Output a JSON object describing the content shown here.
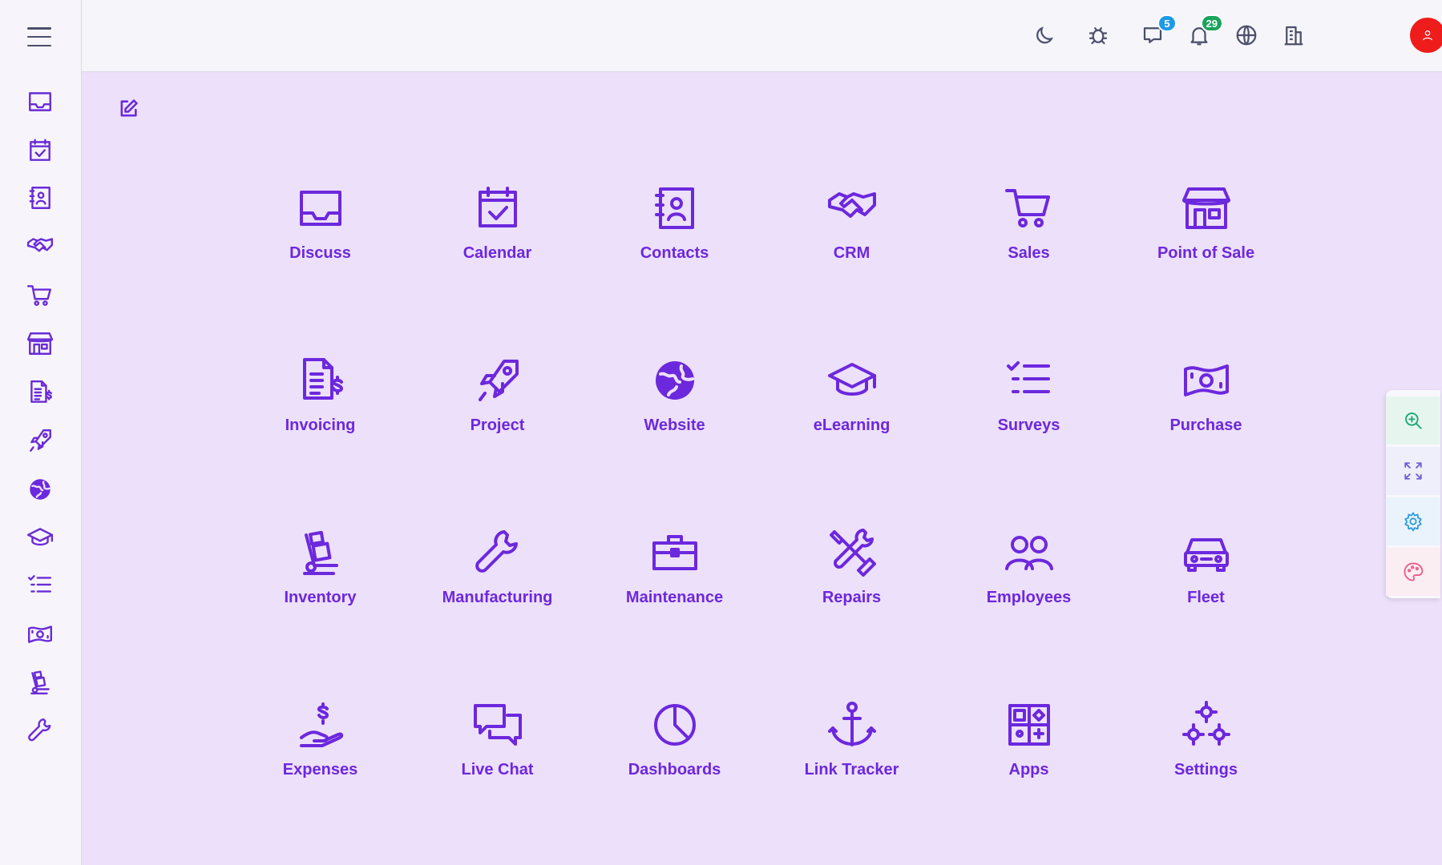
{
  "colors": {
    "accent": "#6c28dd",
    "sidebar_icon": "#6a2bd8",
    "topbar_icon": "#4b4f6b",
    "badge_chat": "#1e9be8",
    "badge_notifications": "#19a35b",
    "avatar_bg": "#ef1c1c",
    "page_bg": "#ede0fb"
  },
  "topbar": {
    "icons": [
      "moon-icon",
      "bug-icon",
      "chat-icon",
      "bell-icon",
      "globe-icon",
      "building-icon"
    ],
    "chat_badge": "5",
    "notification_badge": "29",
    "avatar_icon": "user-icon"
  },
  "sidebar": {
    "items": [
      {
        "name": "Discuss",
        "icon": "inbox-icon"
      },
      {
        "name": "Calendar",
        "icon": "calendar-check-icon"
      },
      {
        "name": "Contacts",
        "icon": "address-book-icon"
      },
      {
        "name": "CRM",
        "icon": "handshake-icon"
      },
      {
        "name": "Sales",
        "icon": "cart-icon"
      },
      {
        "name": "Point of Sale",
        "icon": "store-icon"
      },
      {
        "name": "Invoicing",
        "icon": "invoice-icon"
      },
      {
        "name": "Project",
        "icon": "rocket-icon"
      },
      {
        "name": "Website",
        "icon": "globe-icon"
      },
      {
        "name": "eLearning",
        "icon": "graduation-cap-icon"
      },
      {
        "name": "Surveys",
        "icon": "checklist-icon"
      },
      {
        "name": "Purchase",
        "icon": "banknote-icon"
      },
      {
        "name": "Inventory",
        "icon": "dolly-icon"
      },
      {
        "name": "Manufacturing",
        "icon": "wrench-icon"
      }
    ]
  },
  "apps": [
    {
      "label": "Discuss",
      "icon": "inbox-icon"
    },
    {
      "label": "Calendar",
      "icon": "calendar-check-icon"
    },
    {
      "label": "Contacts",
      "icon": "address-book-icon"
    },
    {
      "label": "CRM",
      "icon": "handshake-icon"
    },
    {
      "label": "Sales",
      "icon": "cart-icon"
    },
    {
      "label": "Point of Sale",
      "icon": "store-icon"
    },
    {
      "label": "Invoicing",
      "icon": "invoice-icon"
    },
    {
      "label": "Project",
      "icon": "rocket-icon"
    },
    {
      "label": "Website",
      "icon": "globe-icon"
    },
    {
      "label": "eLearning",
      "icon": "graduation-cap-icon"
    },
    {
      "label": "Surveys",
      "icon": "checklist-icon"
    },
    {
      "label": "Purchase",
      "icon": "banknote-icon"
    },
    {
      "label": "Inventory",
      "icon": "dolly-icon"
    },
    {
      "label": "Manufacturing",
      "icon": "wrench-icon"
    },
    {
      "label": "Maintenance",
      "icon": "toolbox-icon"
    },
    {
      "label": "Repairs",
      "icon": "tools-icon"
    },
    {
      "label": "Employees",
      "icon": "users-icon"
    },
    {
      "label": "Fleet",
      "icon": "car-icon"
    },
    {
      "label": "Expenses",
      "icon": "hand-dollar-icon"
    },
    {
      "label": "Live Chat",
      "icon": "chat-bubbles-icon"
    },
    {
      "label": "Dashboards",
      "icon": "pie-chart-icon"
    },
    {
      "label": "Link Tracker",
      "icon": "anchor-icon"
    },
    {
      "label": "Apps",
      "icon": "apps-grid-icon"
    },
    {
      "label": "Settings",
      "icon": "gears-icon"
    }
  ],
  "floating_tools": [
    {
      "name": "zoom-in",
      "icon": "zoom-in-icon",
      "color": "#17a673"
    },
    {
      "name": "fullscreen",
      "icon": "expand-icon",
      "color": "#6b5fd6"
    },
    {
      "name": "settings",
      "icon": "gear-icon",
      "color": "#2f9be0"
    },
    {
      "name": "theme",
      "icon": "palette-icon",
      "color": "#ef5a8a"
    }
  ]
}
